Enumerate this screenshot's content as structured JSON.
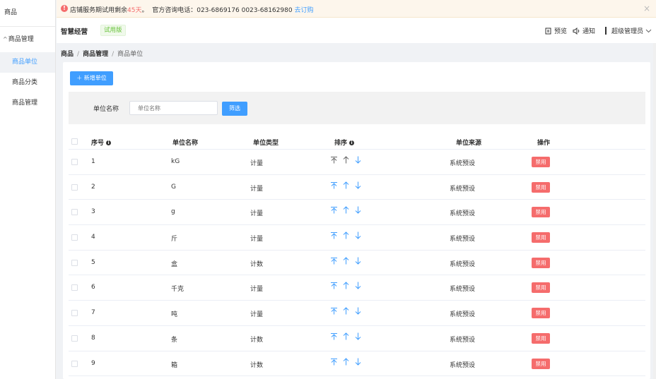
{
  "sidebar": {
    "title": "商品",
    "group": "商品管理",
    "items": [
      {
        "label": "商品单位",
        "active": true
      },
      {
        "label": "商品分类",
        "active": false
      },
      {
        "label": "商品管理",
        "active": false
      }
    ]
  },
  "alert": {
    "prefix": "店铺服务期试用剩余",
    "days": "45天",
    "suffix": "。",
    "contact": "官方咨询电话：023-6869176 0023-68162980",
    "link": "去订购"
  },
  "header": {
    "brand": "智慧经营",
    "trial_badge": "试用版",
    "preview": "预览",
    "notify": "通知",
    "user": "超级管理员"
  },
  "breadcrumb": {
    "root": "商品",
    "mid": "商品管理",
    "current": "商品单位"
  },
  "toolbar": {
    "add_label": "＋ 新增单位"
  },
  "filter": {
    "label": "单位名称",
    "placeholder": "单位名称",
    "button": "筛选"
  },
  "table": {
    "headers": {
      "index": "序号",
      "name": "单位名称",
      "type": "单位类型",
      "sort": "排序",
      "source": "单位来源",
      "action": "操作"
    },
    "rows": [
      {
        "index": "1",
        "name": "kG",
        "type": "计量",
        "source": "系统预设",
        "action": "禁用",
        "top_disabled": true
      },
      {
        "index": "2",
        "name": "G",
        "type": "计量",
        "source": "系统预设",
        "action": "禁用",
        "top_disabled": false
      },
      {
        "index": "3",
        "name": "g",
        "type": "计量",
        "source": "系统预设",
        "action": "禁用",
        "top_disabled": false
      },
      {
        "index": "4",
        "name": "斤",
        "type": "计量",
        "source": "系统预设",
        "action": "禁用",
        "top_disabled": false
      },
      {
        "index": "5",
        "name": "盒",
        "type": "计数",
        "source": "系统预设",
        "action": "禁用",
        "top_disabled": false
      },
      {
        "index": "6",
        "name": "千克",
        "type": "计量",
        "source": "系统预设",
        "action": "禁用",
        "top_disabled": false
      },
      {
        "index": "7",
        "name": "吨",
        "type": "计量",
        "source": "系统预设",
        "action": "禁用",
        "top_disabled": false
      },
      {
        "index": "8",
        "name": "条",
        "type": "计数",
        "source": "系统预设",
        "action": "禁用",
        "top_disabled": false
      },
      {
        "index": "9",
        "name": "箱",
        "type": "计数",
        "source": "系统预设",
        "action": "禁用",
        "top_disabled": false
      }
    ]
  },
  "colors": {
    "primary": "#409eff",
    "danger": "#f56c6c",
    "success": "#67c23a"
  },
  "icons": {
    "sort_top": "arrow-to-top-icon",
    "sort_up": "arrow-up-icon",
    "sort_down": "arrow-down-icon"
  }
}
